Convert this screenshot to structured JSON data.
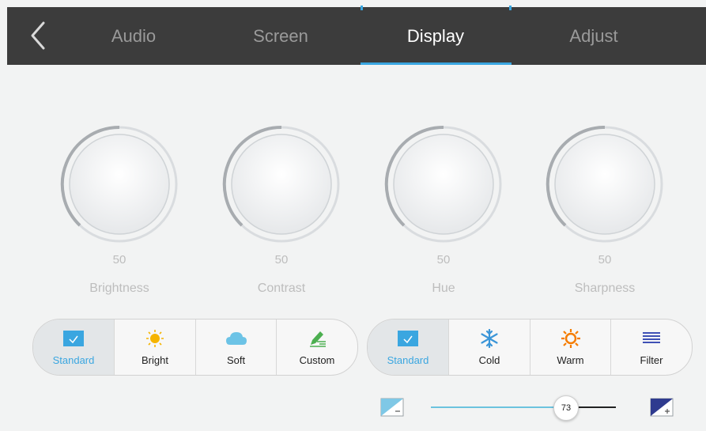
{
  "header": {
    "tabs": [
      {
        "label": "Audio"
      },
      {
        "label": "Screen"
      },
      {
        "label": "Display"
      },
      {
        "label": "Adjust"
      }
    ],
    "active_tab": "Display"
  },
  "knobs": [
    {
      "label": "Brightness",
      "value": "50"
    },
    {
      "label": "Contrast",
      "value": "50"
    },
    {
      "label": "Hue",
      "value": "50"
    },
    {
      "label": "Sharpness",
      "value": "50"
    }
  ],
  "picture_modes": {
    "items": [
      {
        "label": "Standard",
        "icon": "standard-icon",
        "active": true
      },
      {
        "label": "Bright",
        "icon": "sun-icon"
      },
      {
        "label": "Soft",
        "icon": "cloud-icon"
      },
      {
        "label": "Custom",
        "icon": "pencil-icon"
      }
    ]
  },
  "color_temps": {
    "items": [
      {
        "label": "Standard",
        "icon": "standard-icon",
        "active": true
      },
      {
        "label": "Cold",
        "icon": "snowflake-icon"
      },
      {
        "label": "Warm",
        "icon": "warm-sun-icon"
      },
      {
        "label": "Filter",
        "icon": "lines-icon"
      }
    ]
  },
  "slider": {
    "value": "73"
  },
  "colors": {
    "accent": "#3aa6e0",
    "header_bg": "#3c3c3c",
    "sun": "#f5b400",
    "cloud": "#6cc3e6",
    "pencil": "#4caf50",
    "snow": "#3a95d8",
    "warm": "#f57c00",
    "filter": "#3f51b5"
  }
}
